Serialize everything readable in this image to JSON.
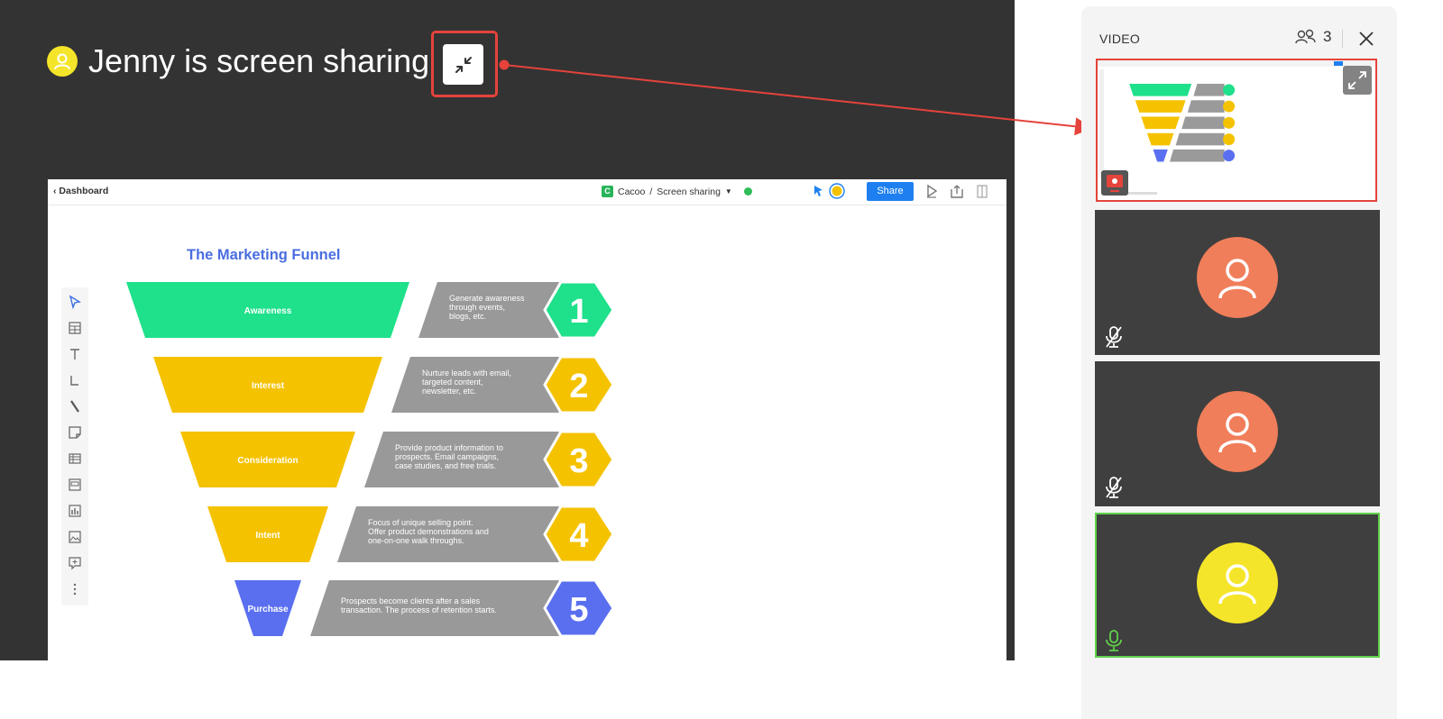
{
  "header": {
    "sharer": "Jenny",
    "sharing_text": "is screen sharing"
  },
  "app": {
    "back_label": "Dashboard",
    "doc_badge": "C",
    "doc_name": "Cacoo",
    "doc_sep": "/",
    "doc_page": "Screen sharing",
    "share_label": "Share"
  },
  "funnel": {
    "title": "The Marketing Funnel",
    "stages": [
      {
        "label": "Awareness",
        "desc": [
          "Generate awareness",
          "through events,",
          "blogs, etc."
        ],
        "number": "1",
        "color": "#1fe08b",
        "hex_color": "#1fe08b"
      },
      {
        "label": "Interest",
        "desc": [
          "Nurture leads with email,",
          "targeted content,",
          "newsletter, etc."
        ],
        "number": "2",
        "color": "#f5c200",
        "hex_color": "#f5c200"
      },
      {
        "label": "Consideration",
        "desc": [
          "Provide product information to",
          "prospects. Email campaigns,",
          "case studies, and free trials."
        ],
        "number": "3",
        "color": "#f5c200",
        "hex_color": "#f5c200"
      },
      {
        "label": "Intent",
        "desc": [
          "Focus of unique selling point.",
          "Offer product demonstrations and",
          "one-on-one walk throughs."
        ],
        "number": "4",
        "color": "#f5c200",
        "hex_color": "#f5c200"
      },
      {
        "label": "Purchase",
        "desc": [
          "Prospects become clients after a sales",
          "transaction. The process of retention starts."
        ],
        "number": "5",
        "color": "#5a6ff0",
        "hex_color": "#5a6ff0"
      }
    ]
  },
  "video": {
    "title": "VIDEO",
    "participant_count": "3",
    "participants": [
      {
        "avatar_color": "#f07e5a",
        "mic": "muted"
      },
      {
        "avatar_color": "#f07e5a",
        "mic": "muted"
      },
      {
        "avatar_color": "#f5e52a",
        "mic": "active"
      }
    ]
  },
  "colors": {
    "highlight": "#e5433b",
    "stage_bg": "#333333",
    "active_speaker": "#5fd34a",
    "share_blue": "#1e80f0"
  }
}
